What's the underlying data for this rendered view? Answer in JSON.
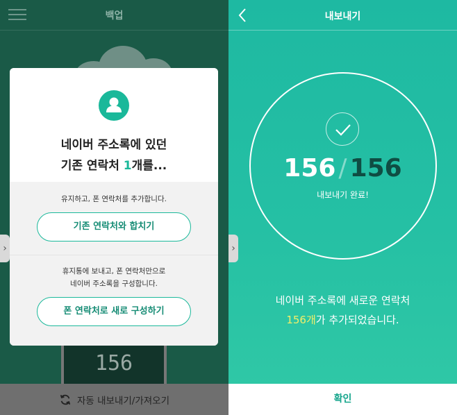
{
  "left_screen": {
    "header": {
      "title": "백업",
      "menu_icon": "hamburger-menu-icon"
    },
    "counter_value": "156",
    "dialog": {
      "icon": "person-icon",
      "title_line1": "네이버 주소록에 있던",
      "title_line2_prefix": "기존 연락처 ",
      "title_line2_highlight": "1",
      "title_line2_suffix": "개를...",
      "option1": {
        "description": "유지하고, 폰 연락처를 추가합니다.",
        "button_label": "기존 연락처와 합치기"
      },
      "option2": {
        "description_line1": "휴지통에 보내고, 폰 연락처만으로",
        "description_line2": "네이버 주소록을 구성합니다.",
        "button_label": "폰 연락처로 새로 구성하기"
      }
    },
    "footer": {
      "label": "자동 내보내기/가져오기",
      "icon": "refresh-icon"
    },
    "side_arrow": "›"
  },
  "right_screen": {
    "header": {
      "title": "내보내기",
      "back_icon": "back-chevron-icon"
    },
    "progress": {
      "done": "156",
      "separator": "/",
      "total": "156",
      "status": "내보내기 완료!",
      "check_icon": "check-icon"
    },
    "message_line1": "네이버 주소록에 새로운 연락처",
    "message_line2_highlight": "156개",
    "message_line2_rest": "가 추가되었습니다.",
    "confirm_label": "확인",
    "side_arrow": "›"
  },
  "colors": {
    "accent": "#1ab89a",
    "highlight_yellow": "#f3ef68",
    "dark_overlay": "#1a5a47"
  }
}
